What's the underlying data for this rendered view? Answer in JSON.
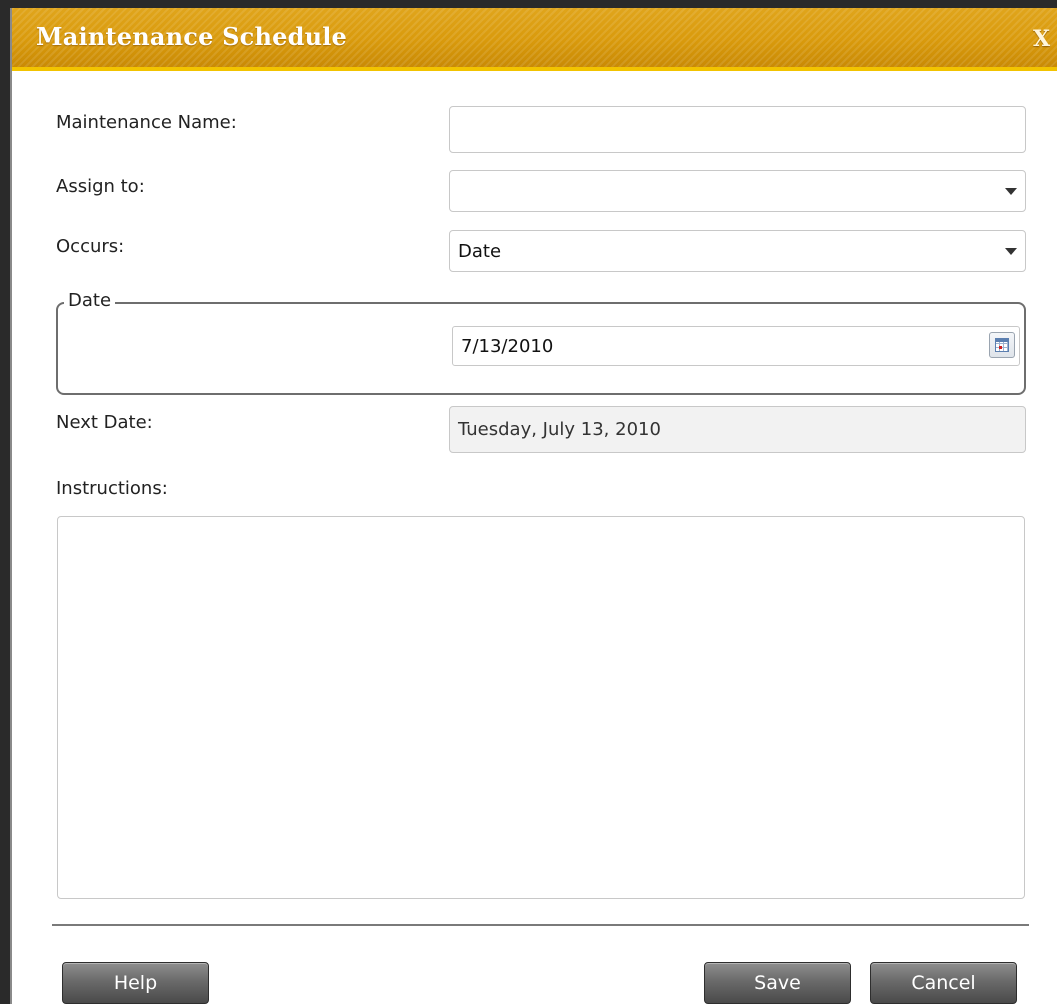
{
  "dialog": {
    "title": "Maintenance Schedule",
    "close_label": "X"
  },
  "form": {
    "maintenance_name": {
      "label": "Maintenance Name:",
      "value": ""
    },
    "assign_to": {
      "label": "Assign to:",
      "value": ""
    },
    "occurs": {
      "label": "Occurs:",
      "value": "Date"
    },
    "date_group": {
      "legend": "Date",
      "date_value": "7/13/2010"
    },
    "next_date": {
      "label": "Next Date:",
      "value": "Tuesday, July 13, 2010"
    },
    "instructions": {
      "label": "Instructions:",
      "value": ""
    }
  },
  "buttons": {
    "help": "Help",
    "save": "Save",
    "cancel": "Cancel"
  },
  "icons": {
    "close": "close-icon",
    "dropdown": "chevron-down-icon",
    "calendar": "calendar-icon"
  },
  "colors": {
    "titlebar": "#d99a0c",
    "titlebar_accent": "#f2c300",
    "button": "#6a6a6a"
  }
}
